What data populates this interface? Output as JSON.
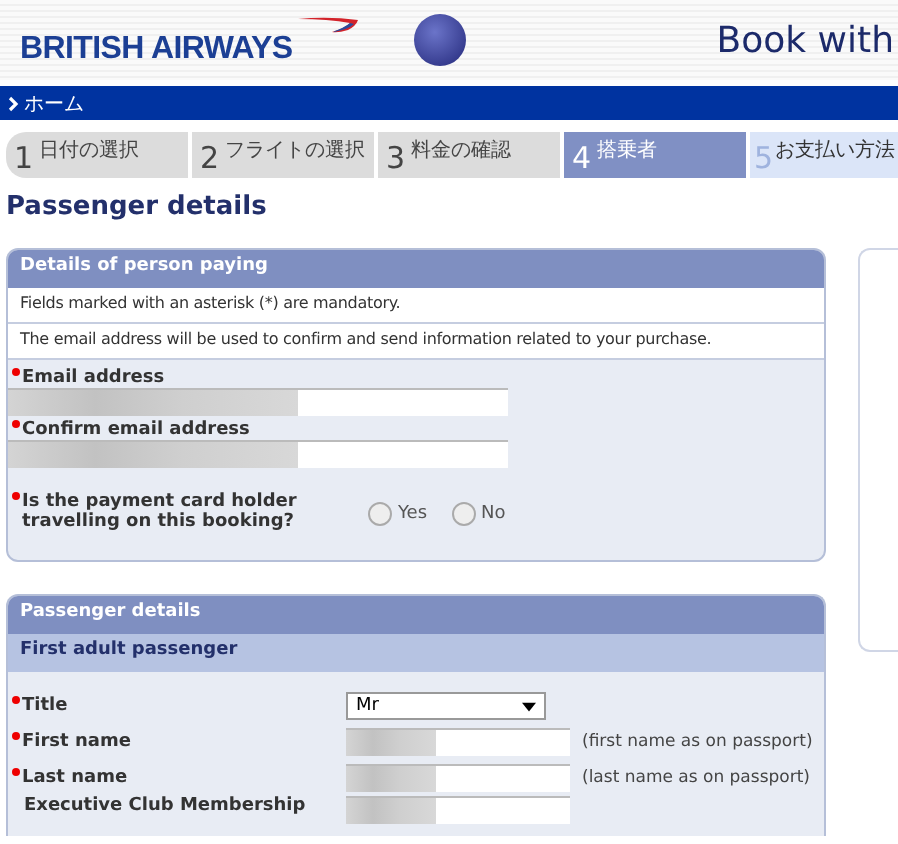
{
  "header": {
    "logo": "BRITISH AIRWAYS",
    "title": "Book with"
  },
  "breadcrumb": {
    "label": "ホーム"
  },
  "steps": [
    {
      "number": "1",
      "label": "日付の選択",
      "kind": "done"
    },
    {
      "number": "2",
      "label": "フライトの選択",
      "kind": "done"
    },
    {
      "number": "3",
      "label": "料金の確認",
      "kind": "done"
    },
    {
      "number": "4",
      "label": "搭乗者",
      "kind": "current"
    },
    {
      "number": "5",
      "label": "お支払い方法",
      "kind": "upcoming"
    }
  ],
  "page_title": "Passenger details",
  "payer": {
    "heading": "Details of person paying",
    "notes": [
      "Fields marked with an asterisk (*) are mandatory.",
      "The email address will be used to confirm and send information related to your purchase."
    ],
    "fields": [
      {
        "kind": "text",
        "label": "Email address",
        "required": true,
        "filled": true
      },
      {
        "kind": "text",
        "label": "Confirm email address",
        "required": true,
        "filled": true
      },
      {
        "kind": "radio",
        "label": "Is the payment card holder travelling on this booking?",
        "required": true,
        "options": [
          {
            "label": "Yes",
            "selected": false
          },
          {
            "label": "No",
            "selected": false
          }
        ]
      }
    ]
  },
  "passenger": {
    "heading": "Passenger details",
    "subheading": "First adult passenger",
    "fields": [
      {
        "kind": "select",
        "label": "Title",
        "required": true,
        "value": "Mr"
      },
      {
        "kind": "text",
        "label": "First name",
        "required": true,
        "filled": true,
        "hint": "(first name as on passport)"
      },
      {
        "kind": "text",
        "label": "Last name",
        "required": true,
        "filled": true,
        "hint": "(last name as on passport)"
      },
      {
        "kind": "text",
        "label": "Executive Club Membership",
        "filled": true
      }
    ]
  }
}
